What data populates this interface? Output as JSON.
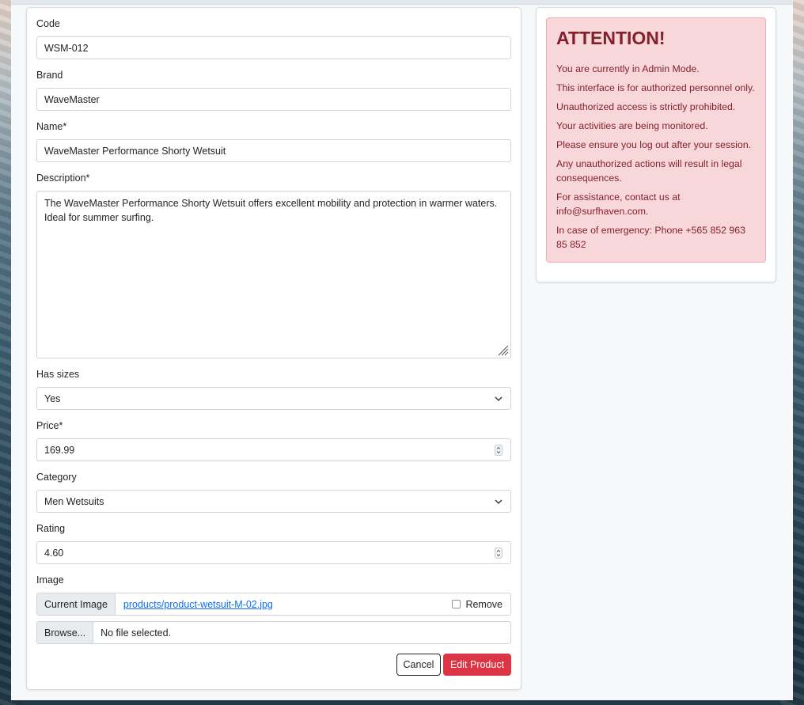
{
  "form": {
    "code": {
      "label": "Code",
      "value": "WSM-012"
    },
    "brand": {
      "label": "Brand",
      "value": "WaveMaster"
    },
    "name": {
      "label": "Name*",
      "value": "WaveMaster Performance Shorty Wetsuit"
    },
    "description": {
      "label": "Description*",
      "value": "The WaveMaster Performance Shorty Wetsuit offers excellent mobility and protection in warmer waters. Ideal for summer surfing."
    },
    "has_sizes": {
      "label": "Has sizes",
      "value": "Yes"
    },
    "price": {
      "label": "Price*",
      "value": "169.99"
    },
    "category": {
      "label": "Category",
      "value": "Men Wetsuits"
    },
    "rating": {
      "label": "Rating",
      "value": "4.60"
    },
    "image": {
      "label": "Image",
      "current_label": "Current Image",
      "current_file": "products/product-wetsuit-M-02.jpg",
      "remove_label": "Remove",
      "browse_label": "Browse...",
      "no_file": "No file selected."
    },
    "cancel_label": "Cancel",
    "submit_label": "Edit Product"
  },
  "alert": {
    "title": "ATTENTION!",
    "lines": [
      "You are currently in Admin Mode.",
      "This interface is for authorized personnel only.",
      "Unauthorized access is strictly prohibited.",
      "Your activities are being monitored.",
      "Please ensure you log out after your session.",
      "Any unauthorized actions will result in legal consequences.",
      "For assistance, contact us at info@surfhaven.com.",
      "In case of emergency: Phone +565 852 963 85 852"
    ]
  },
  "colors": {
    "danger": "#dc3545",
    "alert_bg": "#f8d7da",
    "alert_text": "#842029",
    "link": "#0d6efd"
  }
}
